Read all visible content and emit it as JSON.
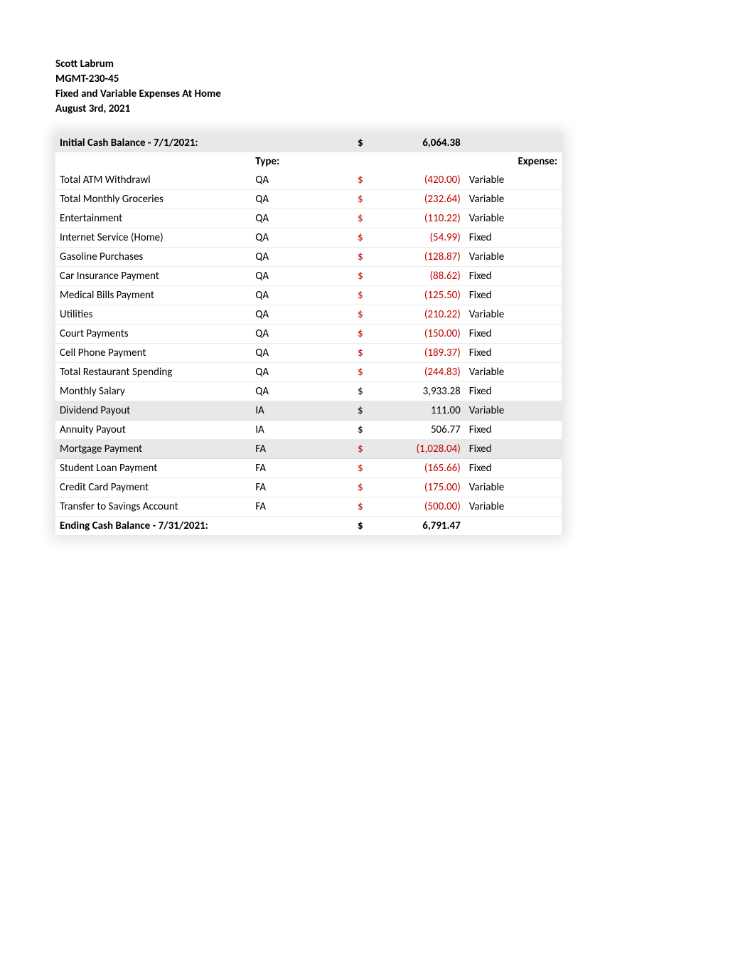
{
  "header": {
    "name": "Scott Labrum",
    "course": "MGMT-230-45",
    "title": "Fixed and Variable Expenses At Home",
    "date": "August 3rd, 2021"
  },
  "table": {
    "initial_label": "Initial Cash Balance - 7/1/2021:",
    "ending_label": "Ending Cash Balance - 7/31/2021:",
    "type_header": "Type:",
    "expense_header": "Expense:",
    "dollar_sign": "$",
    "initial_balance": "6,064.38",
    "ending_balance": "6,791.47",
    "rows": [
      {
        "desc": "Total ATM Withdrawl",
        "type": "QA",
        "amount": "(420.00)",
        "neg": true,
        "expense": "Variable",
        "shade": false
      },
      {
        "desc": "Total Monthly Groceries",
        "type": "QA",
        "amount": "(232.64)",
        "neg": true,
        "expense": "Variable",
        "shade": false
      },
      {
        "desc": "Entertainment",
        "type": "QA",
        "amount": "(110.22)",
        "neg": true,
        "expense": "Variable",
        "shade": false
      },
      {
        "desc": "Internet Service (Home)",
        "type": "QA",
        "amount": "(54.99)",
        "neg": true,
        "expense": "Fixed",
        "shade": false
      },
      {
        "desc": "Gasoline Purchases",
        "type": "QA",
        "amount": "(128.87)",
        "neg": true,
        "expense": "Variable",
        "shade": false
      },
      {
        "desc": "Car Insurance Payment",
        "type": "QA",
        "amount": "(88.62)",
        "neg": true,
        "expense": "Fixed",
        "shade": false
      },
      {
        "desc": "Medical Bills Payment",
        "type": "QA",
        "amount": "(125.50)",
        "neg": true,
        "expense": "Fixed",
        "shade": false
      },
      {
        "desc": "Utilities",
        "type": "QA",
        "amount": "(210.22)",
        "neg": true,
        "expense": "Variable",
        "shade": false
      },
      {
        "desc": "Court Payments",
        "type": "QA",
        "amount": "(150.00)",
        "neg": true,
        "expense": "Fixed",
        "shade": false
      },
      {
        "desc": "Cell Phone Payment",
        "type": "QA",
        "amount": "(189.37)",
        "neg": true,
        "expense": "Fixed",
        "shade": false
      },
      {
        "desc": "Total Restaurant Spending",
        "type": "QA",
        "amount": "(244.83)",
        "neg": true,
        "expense": "Variable",
        "shade": false
      },
      {
        "desc": "Monthly Salary",
        "type": "QA",
        "amount": "3,933.28",
        "neg": false,
        "expense": "Fixed",
        "shade": false
      },
      {
        "desc": "Dividend Payout",
        "type": "IA",
        "amount": "111.00",
        "neg": false,
        "expense": "Variable",
        "shade": true
      },
      {
        "desc": "Annuity Payout",
        "type": "IA",
        "amount": "506.77",
        "neg": false,
        "expense": "Fixed",
        "shade": false
      },
      {
        "desc": "Mortgage Payment",
        "type": "FA",
        "amount": "(1,028.04)",
        "neg": true,
        "expense": "Fixed",
        "shade": true
      },
      {
        "desc": "Student Loan Payment",
        "type": "FA",
        "amount": "(165.66)",
        "neg": true,
        "expense": "Fixed",
        "shade": false
      },
      {
        "desc": "Credit Card Payment",
        "type": "FA",
        "amount": "(175.00)",
        "neg": true,
        "expense": "Variable",
        "shade": false
      },
      {
        "desc": "Transfer to Savings Account",
        "type": "FA",
        "amount": "(500.00)",
        "neg": true,
        "expense": "Variable",
        "shade": false
      }
    ]
  }
}
